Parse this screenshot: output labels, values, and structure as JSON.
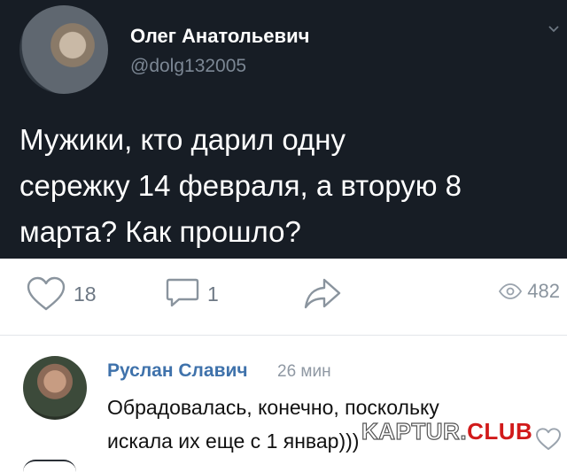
{
  "tweet": {
    "author_name": "Олег Анатольевич",
    "handle": "@dolg132005",
    "text_lines": [
      "Мужики, кто дарил одну",
      "сережку 14 февраля, а вторую 8",
      "марта? Как прошло?"
    ],
    "colors": {
      "background": "#171d25",
      "text": "#ffffff",
      "handle": "#7c8794"
    }
  },
  "actions": {
    "like_icon": "heart-outline-icon",
    "like_count": "18",
    "comment_icon": "speech-bubble-icon",
    "comment_count": "1",
    "share_icon": "share-arrow-icon",
    "views_icon": "eye-icon",
    "views_count": "482"
  },
  "comment": {
    "author_name": "Руслан Славич",
    "time": "26 мин",
    "text_lines": [
      "Обрадовалась, конечно, поскольку",
      "искала их еще с 1 январ)))"
    ],
    "like_icon": "heart-outline-icon",
    "colors": {
      "author": "#3f72ab"
    }
  },
  "watermark": {
    "part1": "KAPTUR.",
    "part2": "CLUB"
  }
}
